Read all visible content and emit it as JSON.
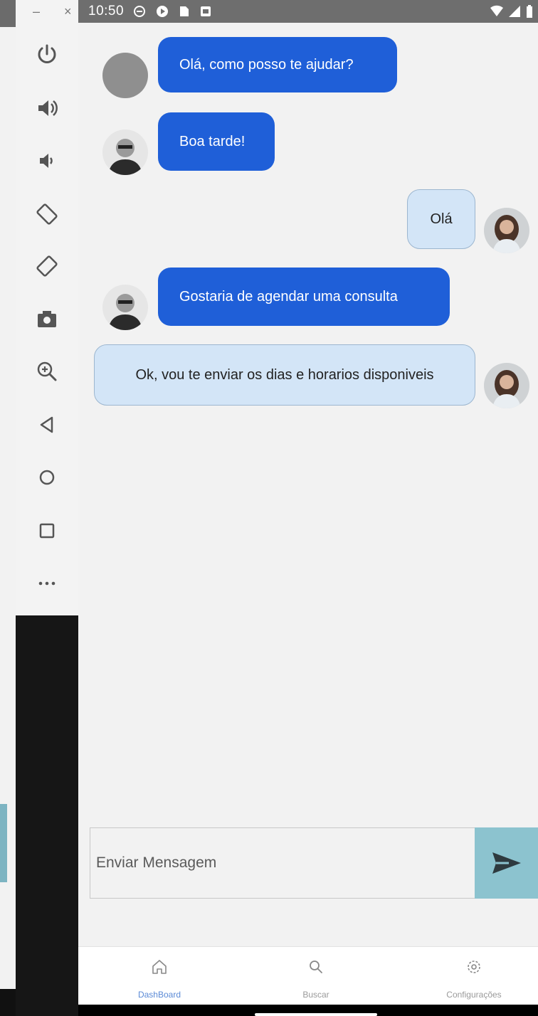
{
  "status_bar": {
    "time": "10:50",
    "left_icons": [
      "vpn-key-icon",
      "play-icon",
      "sim-card-icon",
      "notification-icon"
    ],
    "right_icons": [
      "wifi-icon",
      "cell-signal-icon",
      "battery-icon"
    ]
  },
  "emulator_toolbar": {
    "window_controls": {
      "minimize": "–",
      "close": "×"
    },
    "buttons": [
      "power-icon",
      "volume-up-icon",
      "volume-down-icon",
      "rotate-left-icon",
      "rotate-right-icon",
      "camera-icon",
      "zoom-in-icon",
      "back-icon",
      "home-icon",
      "overview-icon",
      "more-icon"
    ]
  },
  "chat": {
    "messages": [
      {
        "sender": "bot",
        "text": "Olá, como posso te ajudar?",
        "avatar": "gray-placeholder"
      },
      {
        "sender": "bot",
        "text": "Boa tarde!",
        "avatar": "man-photo"
      },
      {
        "sender": "user",
        "text": "Olá",
        "avatar": "woman-photo"
      },
      {
        "sender": "bot",
        "text": "Gostaria de agendar uma consulta",
        "avatar": "man-photo"
      },
      {
        "sender": "user",
        "text": "Ok, vou te enviar os dias e horarios disponiveis",
        "avatar": "woman-photo"
      }
    ]
  },
  "composer": {
    "placeholder": "Enviar Mensagem",
    "send_icon": "send-icon"
  },
  "bottom_nav": {
    "items": [
      {
        "label": "DashBoard",
        "icon": "home-icon",
        "active": true
      },
      {
        "label": "Buscar",
        "icon": "search-icon",
        "active": false
      },
      {
        "label": "Configurações",
        "icon": "gear-icon",
        "active": false
      }
    ]
  },
  "colors": {
    "bot_bubble": "#1f5fd8",
    "user_bubble": "#d3e5f7",
    "send_button": "#8cc3cf",
    "nav_active": "#5b8ad6",
    "status_bar": "#6e6e6e"
  }
}
